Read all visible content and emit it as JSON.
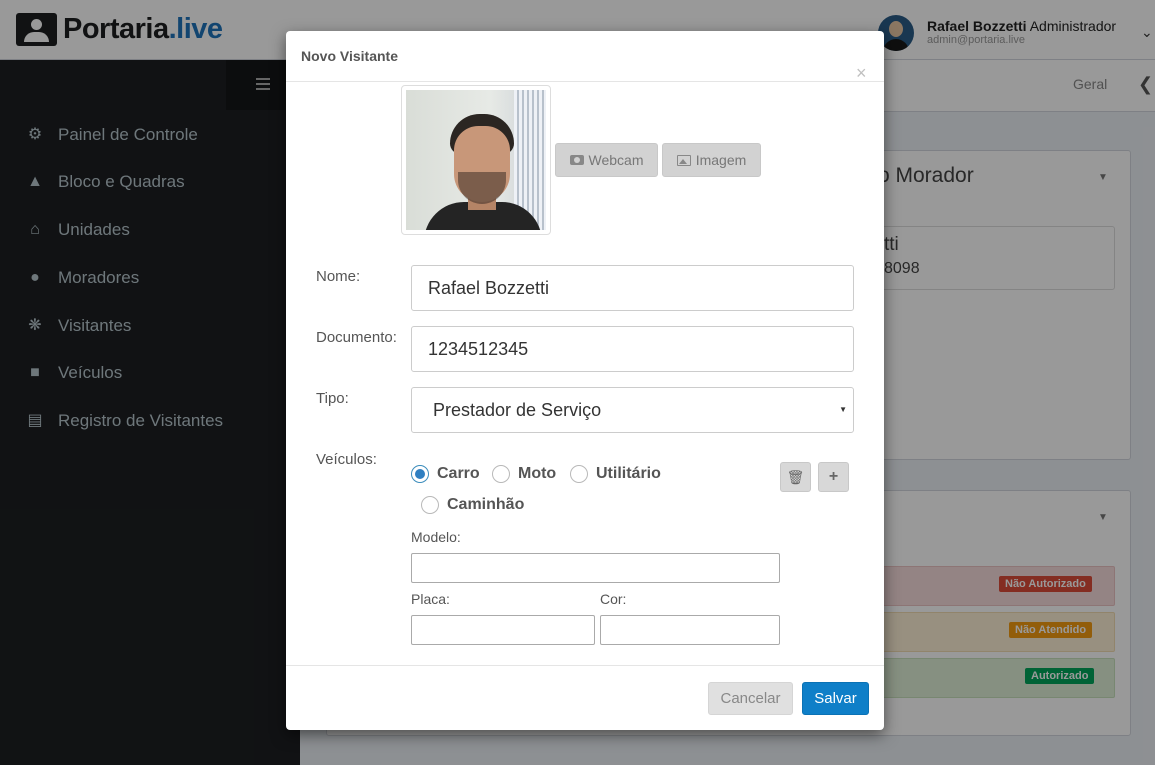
{
  "app": {
    "logo_main": "Portaria",
    "logo_accent": ".live"
  },
  "user": {
    "name": "Rafael Bozzetti",
    "role": "Administrador",
    "email": "admin@portaria.live"
  },
  "sidebar": {
    "items": [
      {
        "label": "Painel de Controle",
        "icon": "dashboard-icon"
      },
      {
        "label": "Bloco e Quadras",
        "icon": "sitemap-icon"
      },
      {
        "label": "Unidades",
        "icon": "home-icon"
      },
      {
        "label": "Moradores",
        "icon": "user-icon"
      },
      {
        "label": "Visitantes",
        "icon": "person-icon"
      },
      {
        "label": "Veículos",
        "icon": "truck-icon"
      },
      {
        "label": "Registro de Visitantes",
        "icon": "file-icon"
      }
    ]
  },
  "header": {
    "breadcrumb": "Geral"
  },
  "background": {
    "card_title": "o Morador",
    "inner_line1": "tti",
    "inner_line2": "8098",
    "status_labels": {
      "red": "Não Autorizado",
      "yellow": "Não Atendido",
      "green": "Autorizado"
    }
  },
  "modal": {
    "title": "Novo Visitante",
    "close": "×",
    "photo": {
      "webcam_label": "Webcam",
      "image_label": "Imagem"
    },
    "fields": {
      "nome_label": "Nome:",
      "nome_value": "Rafael Bozzetti",
      "documento_label": "Documento:",
      "documento_value": "1234512345",
      "tipo_label": "Tipo:",
      "tipo_value": "Prestador de Serviço",
      "veiculos_label": "Veículos:"
    },
    "vehicle_types": [
      {
        "label": "Carro",
        "checked": true
      },
      {
        "label": "Moto",
        "checked": false
      },
      {
        "label": "Utilitário",
        "checked": false
      },
      {
        "label": "Caminhão",
        "checked": false
      }
    ],
    "vehicle_fields": {
      "modelo_label": "Modelo:",
      "modelo_value": "",
      "placa_label": "Placa:",
      "placa_value": "",
      "cor_label": "Cor:",
      "cor_value": ""
    },
    "footer": {
      "cancel_label": "Cancelar",
      "save_label": "Salvar"
    }
  },
  "colors": {
    "primary": "#0f7fc8",
    "sidebar_bg": "#1d1f22",
    "danger": "#dd4b39",
    "warning": "#f39c12",
    "success": "#00a65a"
  }
}
